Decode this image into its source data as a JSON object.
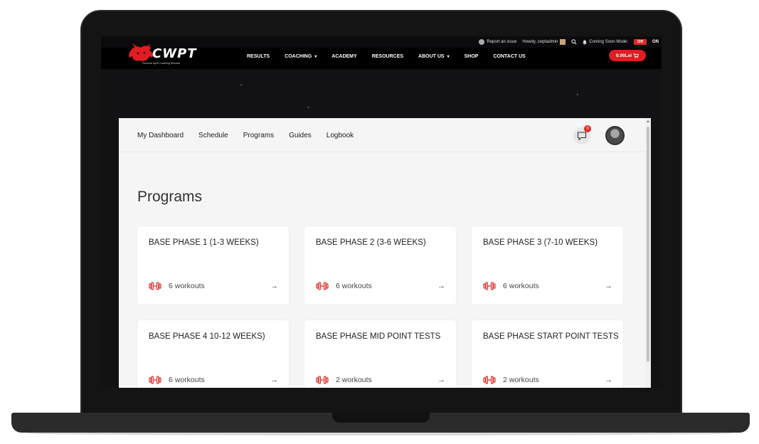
{
  "admin_bar": {
    "report_issue": "Report an issue",
    "howdy": "Howdy, cwptadmin",
    "coming_soon_label": "Coming Soon Mode:",
    "toggle_off": "Off",
    "toggle_on": "ON"
  },
  "brand": {
    "name": "CWPT",
    "tagline": "Personal Sport Coaching Services",
    "accent": "#e31b23"
  },
  "nav": {
    "items": [
      {
        "label": "RESULTS",
        "dropdown": false
      },
      {
        "label": "COACHING",
        "dropdown": true
      },
      {
        "label": "ACADEMY",
        "dropdown": false
      },
      {
        "label": "RESOURCES",
        "dropdown": false
      },
      {
        "label": "ABOUT US",
        "dropdown": true
      },
      {
        "label": "SHOP",
        "dropdown": false
      },
      {
        "label": "CONTACT US",
        "dropdown": false
      }
    ],
    "cart_total": "0.00Lei"
  },
  "subnav": {
    "items": [
      "My Dashboard",
      "Schedule",
      "Programs",
      "Guides",
      "Logbook"
    ],
    "notification_count": "0"
  },
  "page": {
    "title": "Programs"
  },
  "programs": [
    {
      "title": "BASE PHASE 1 (1-3 WEEKS)",
      "workouts": "6 workouts"
    },
    {
      "title": "BASE PHASE 2 (3-6 WEEKS)",
      "workouts": "6 workouts"
    },
    {
      "title": "BASE PHASE 3 (7-10 WEEKS)",
      "workouts": "6 workouts"
    },
    {
      "title": "BASE PHASE 4 10-12 WEEKS)",
      "workouts": "6 workouts"
    },
    {
      "title": "BASE PHASE MID POINT TESTS",
      "workouts": "2 workouts"
    },
    {
      "title": "BASE PHASE START POINT TESTS",
      "workouts": "2 workouts"
    }
  ],
  "icons": {
    "workout": "dumbbell-icon",
    "open": "arrow-right-icon",
    "chat": "chat-icon",
    "search": "search-icon",
    "cart": "cart-icon"
  }
}
